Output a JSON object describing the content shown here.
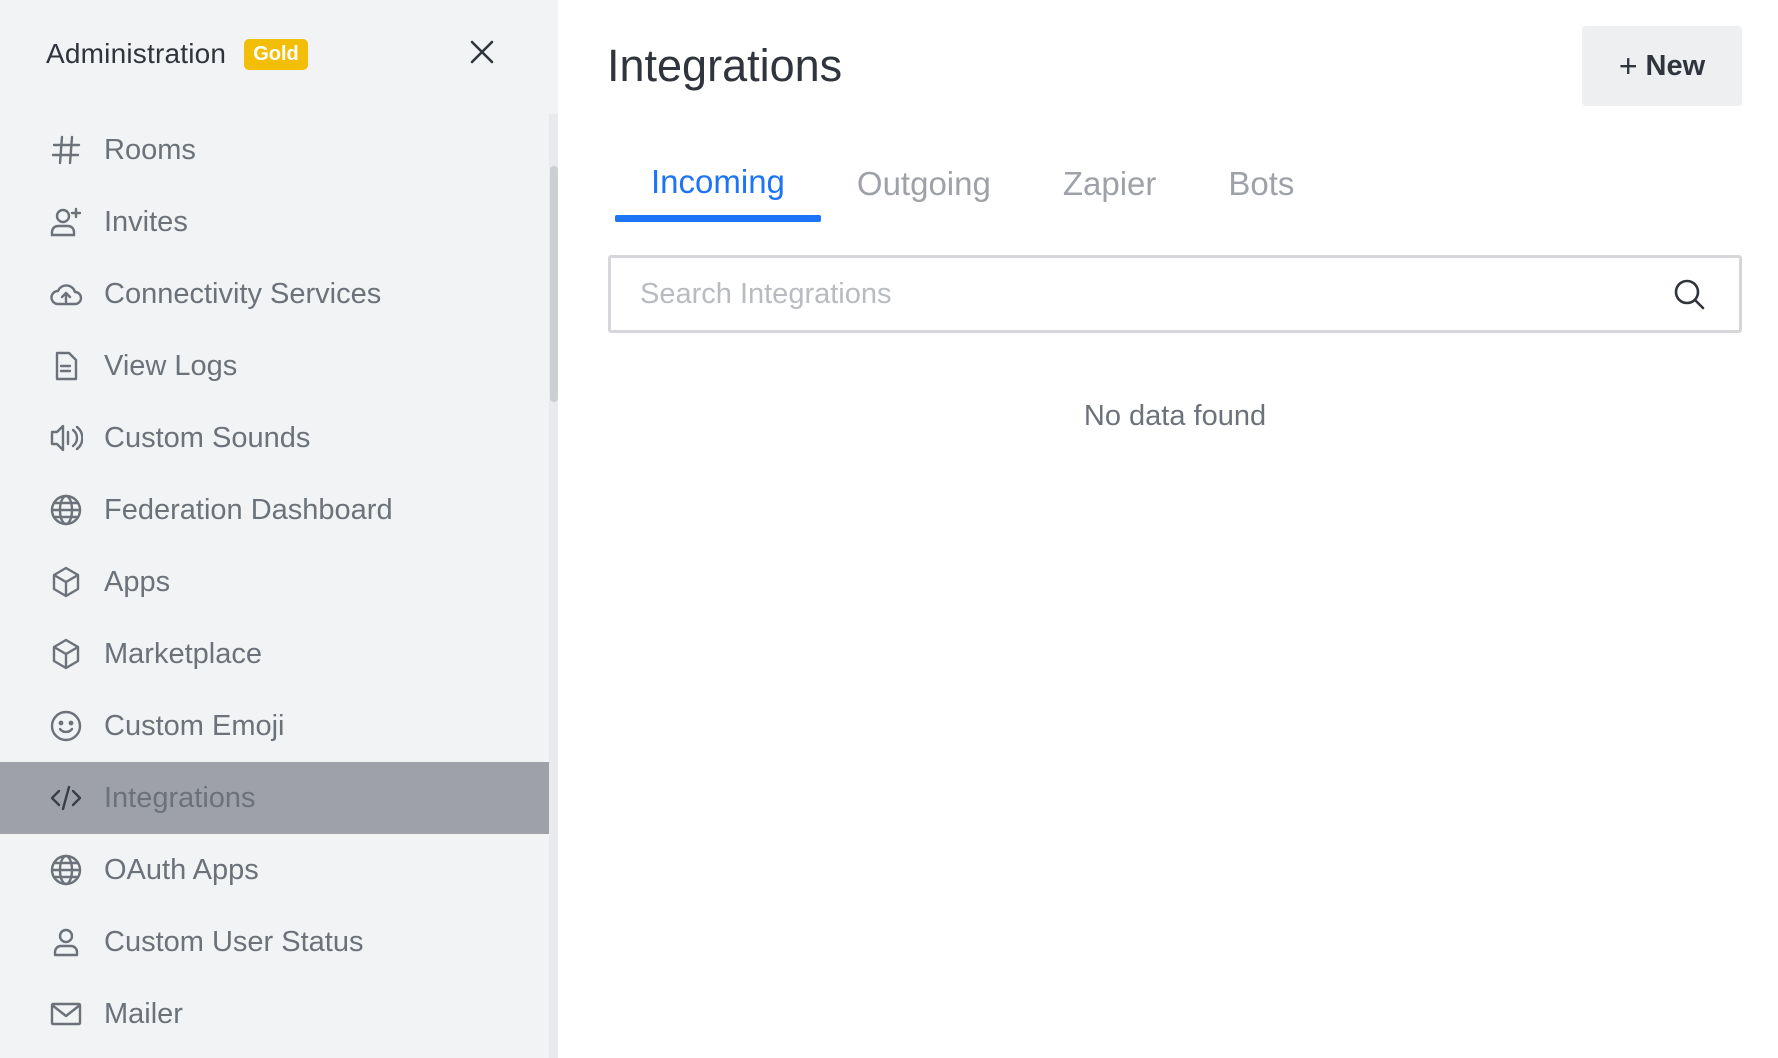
{
  "sidebar": {
    "title": "Administration",
    "badge": "Gold",
    "items": [
      {
        "label": "Rooms",
        "icon": "hash-icon",
        "active": false
      },
      {
        "label": "Invites",
        "icon": "user-plus-icon",
        "active": false
      },
      {
        "label": "Connectivity Services",
        "icon": "cloud-icon",
        "active": false
      },
      {
        "label": "View Logs",
        "icon": "document-icon",
        "active": false
      },
      {
        "label": "Custom Sounds",
        "icon": "speaker-icon",
        "active": false
      },
      {
        "label": "Federation Dashboard",
        "icon": "globe-icon",
        "active": false
      },
      {
        "label": "Apps",
        "icon": "cube-icon",
        "active": false
      },
      {
        "label": "Marketplace",
        "icon": "cube-icon",
        "active": false
      },
      {
        "label": "Custom Emoji",
        "icon": "emoji-icon",
        "active": false
      },
      {
        "label": "Integrations",
        "icon": "code-icon",
        "active": true
      },
      {
        "label": "OAuth Apps",
        "icon": "globe-icon",
        "active": false
      },
      {
        "label": "Custom User Status",
        "icon": "user-icon",
        "active": false
      },
      {
        "label": "Mailer",
        "icon": "mail-icon",
        "active": false
      }
    ]
  },
  "main": {
    "title": "Integrations",
    "new_button": {
      "plus": "+",
      "label": "New"
    },
    "tabs": [
      {
        "label": "Incoming",
        "active": true
      },
      {
        "label": "Outgoing",
        "active": false
      },
      {
        "label": "Zapier",
        "active": false
      },
      {
        "label": "Bots",
        "active": false
      }
    ],
    "search": {
      "placeholder": "Search Integrations",
      "value": ""
    },
    "empty_message": "No data found"
  },
  "colors": {
    "accent": "#1d74f5",
    "gold": "#f3be08",
    "sidebar_bg": "#f2f3f5",
    "active_item_bg": "#9ea2a8"
  }
}
